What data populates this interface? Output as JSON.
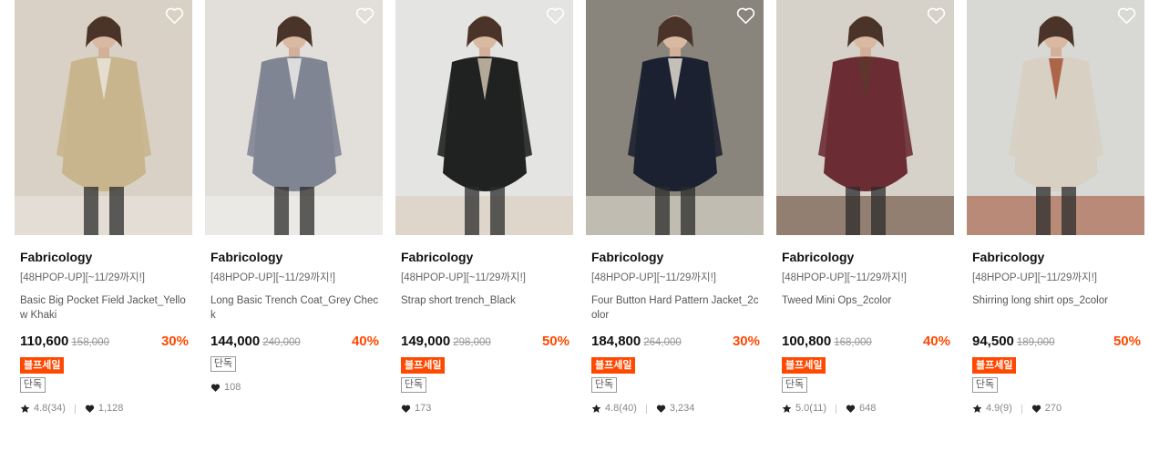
{
  "products": [
    {
      "brand": "Fabricology",
      "promo": "[48HPOP-UP][~11/29까지!]",
      "name": "Basic Big Pocket Field Jacket_Yellow Khaki",
      "price": "110,600",
      "original_price": "158,000",
      "discount": "30%",
      "sale_badge": "블프세일",
      "exclusive_badge": "단독",
      "rating": "4.8(34)",
      "likes": "1,128",
      "image": "woman in khaki field jacket near window",
      "colors": {
        "bg": "#d9d1c5",
        "garment": "#c8b58d",
        "accent": "#ece8e1"
      }
    },
    {
      "brand": "Fabricology",
      "promo": "[48HPOP-UP][~11/29까지!]",
      "name": "Long Basic Trench Coat_Grey Check",
      "price": "144,000",
      "original_price": "240,000",
      "discount": "40%",
      "sale_badge": null,
      "exclusive_badge": "단독",
      "rating": null,
      "likes": "108",
      "image": "woman in grey check trench coat",
      "colors": {
        "bg": "#e2dfdb",
        "garment": "#7f8592",
        "accent": "#f3f1ee"
      }
    },
    {
      "brand": "Fabricology",
      "promo": "[48HPOP-UP][~11/29까지!]",
      "name": "Strap short trench_Black",
      "price": "149,000",
      "original_price": "298,000",
      "discount": "50%",
      "sale_badge": "블프세일",
      "exclusive_badge": "단독",
      "rating": null,
      "likes": "173",
      "image": "woman in black short belted trench",
      "colors": {
        "bg": "#e4e4e2",
        "garment": "#1f2220",
        "accent": "#d9cbb7"
      }
    },
    {
      "brand": "Fabricology",
      "promo": "[48HPOP-UP][~11/29까지!]",
      "name": "Four Button Hard Pattern Jacket_2color",
      "price": "184,800",
      "original_price": "264,000",
      "discount": "30%",
      "sale_badge": "블프세일",
      "exclusive_badge": "단독",
      "rating": "4.8(40)",
      "likes": "3,234",
      "image": "woman in navy four button jacket",
      "colors": {
        "bg": "#8a857c",
        "garment": "#1b2130",
        "accent": "#efe9dc"
      }
    },
    {
      "brand": "Fabricology",
      "promo": "[48HPOP-UP][~11/29까지!]",
      "name": "Tweed Mini Ops_2color",
      "price": "100,800",
      "original_price": "168,000",
      "discount": "40%",
      "sale_badge": "블프세일",
      "exclusive_badge": "단독",
      "rating": "5.0(11)",
      "likes": "648",
      "image": "woman in burgundy tweed mini dress",
      "colors": {
        "bg": "#d7d2c9",
        "garment": "#6b2c34",
        "accent": "#5b3a2a"
      }
    },
    {
      "brand": "Fabricology",
      "promo": "[48HPOP-UP][~11/29까지!]",
      "name": "Shirring long shirt ops_2color",
      "price": "94,500",
      "original_price": "189,000",
      "discount": "50%",
      "sale_badge": "블프세일",
      "exclusive_badge": "단독",
      "rating": "4.9(9)",
      "likes": "270",
      "image": "woman in beige long shirt dress by window",
      "colors": {
        "bg": "#d8d8d4",
        "garment": "#d8d0c3",
        "accent": "#a14a2a"
      }
    }
  ],
  "icons": {
    "wishlist": "heart-outline-icon",
    "rating": "star-icon",
    "likes": "heart-filled-icon"
  },
  "theme": {
    "discount_color": "#ff4800",
    "sale_badge_bg": "#ff4800"
  }
}
